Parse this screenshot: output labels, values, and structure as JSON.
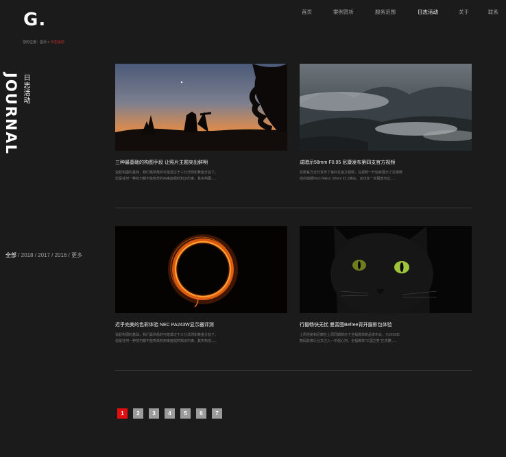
{
  "logo": "G.",
  "breadcrumb": {
    "prefix": "您的位置：",
    "home": "首页",
    "sep": " > ",
    "current": "日志活动"
  },
  "nav": [
    "首页",
    "案例赏析",
    "服务范围",
    "日志活动",
    "关于",
    "联系"
  ],
  "section": {
    "title_en": "JOURNAL",
    "title_cn": "日志活动"
  },
  "filter": {
    "all": "全部",
    "y2018": "2018",
    "y2017": "2017",
    "y2016": "2016",
    "more": "更多",
    "sep": " / "
  },
  "articles": [
    {
      "title": "三种最基础的构图手段 让照片主题突出鲜明",
      "desc_1": "说起构图的基础，我们最熟悉的可能莫过于三分法则和黄金分割了。",
      "desc_2": "但是任何一种技巧都不能简单的用来面视的知识约束。其实构图......",
      "image": "sunset-photographer"
    },
    {
      "title": "成暗示58mm F0.95 尼康发布第四支官方视频",
      "desc_1": "尼康官方近日发布了第四支官方视频，在视频一开始就展示了尼康微",
      "desc_2": "结的旗舰Noct-Nikkor 58mm f/1.2镜头，这也在一定程度印证......",
      "image": "misty-mountains"
    },
    {
      "title": "近乎完美的色彩体验 NEC PA243W显示器评测",
      "desc_1": "说起构图的基础，我们最熟悉的可能莫过于三分法则和黄金分割了。",
      "desc_2": "但是任何一种技巧都不能简单的用来面视的知识约束。其实构造......",
      "image": "light-ring"
    },
    {
      "title": "行摄畅快无忧 曼富图Befree背开摄影包体验",
      "desc_1": "上周佳能和尼康在上周同期举办了全幅微单新品发布会。为2018年",
      "desc_2": "数码影像行业又注入一剂强心剂。全幅微单\"三国之势\"正式确......",
      "image": "black-cat"
    }
  ],
  "pagination": [
    "1",
    "2",
    "3",
    "4",
    "5",
    "6",
    "7"
  ],
  "colors": {
    "background": "#1b1b1b",
    "accent": "#e10f0f",
    "pager_inactive": "#9b9b9b"
  }
}
